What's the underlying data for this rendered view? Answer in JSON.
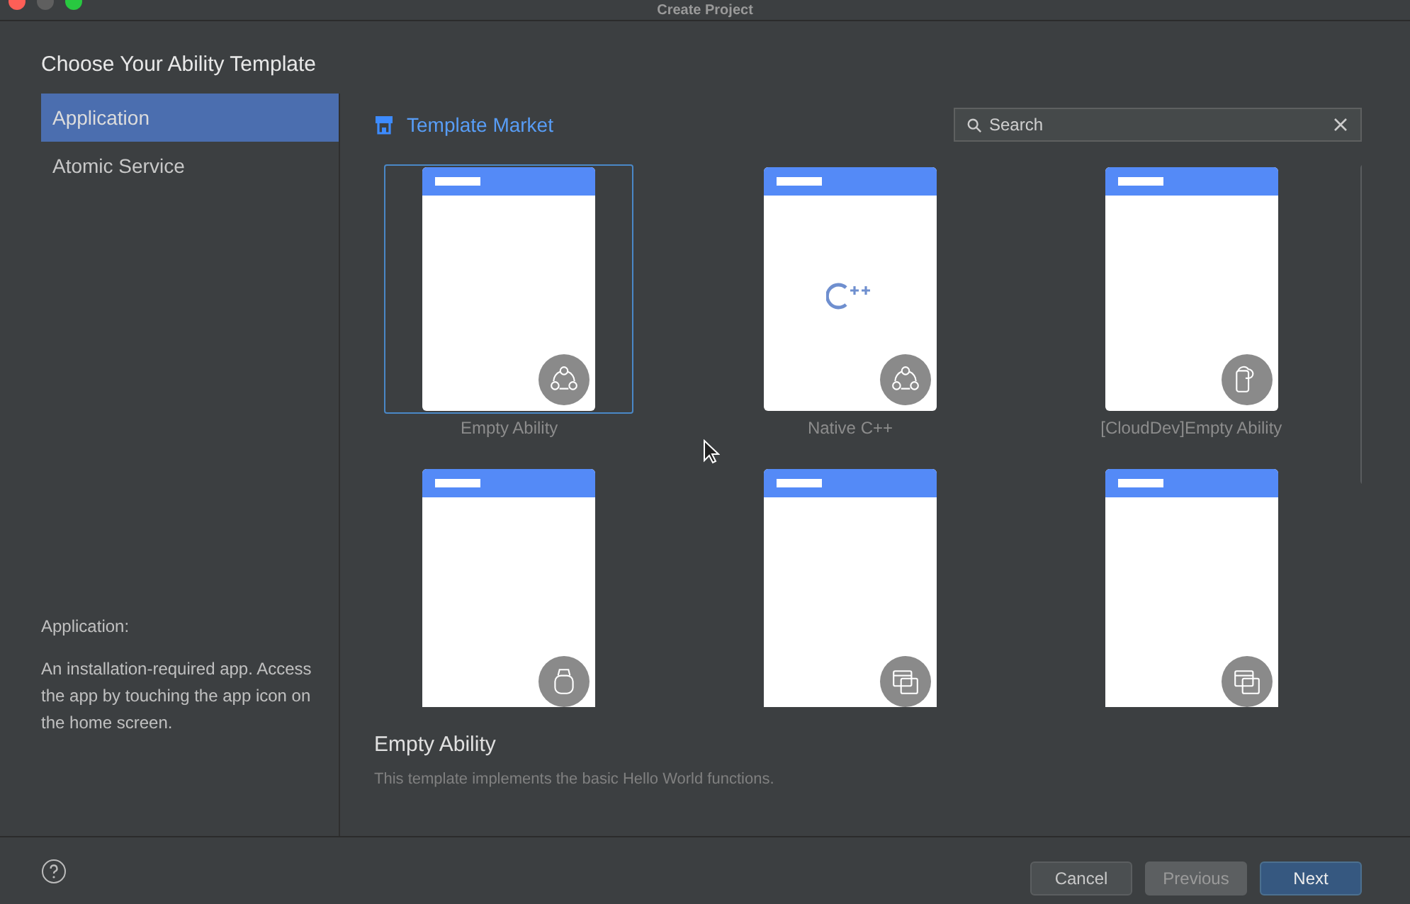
{
  "window": {
    "title": "Create Project"
  },
  "heading": "Choose Your Ability Template",
  "sidebar": {
    "items": [
      {
        "label": "Application",
        "selected": true
      },
      {
        "label": "Atomic Service",
        "selected": false
      }
    ],
    "info_title": "Application:",
    "info_text": "An installation-required app. Access the app by touching the app icon on the home screen."
  },
  "market": {
    "label": "Template Market"
  },
  "search": {
    "placeholder": "Search"
  },
  "templates": [
    {
      "label": "Empty Ability",
      "selected": true
    },
    {
      "label": "Native C++",
      "selected": false
    },
    {
      "label": "[CloudDev]Empty Ability",
      "selected": false
    },
    {
      "selected": false
    },
    {
      "selected": false
    },
    {
      "selected": false
    }
  ],
  "detail": {
    "title": "Empty Ability",
    "description": "This template implements the basic Hello World functions."
  },
  "buttons": [
    {
      "label": "Cancel",
      "kind": "normal"
    },
    {
      "label": "Previous",
      "kind": "disabled"
    },
    {
      "label": "Next",
      "kind": "primary"
    }
  ]
}
